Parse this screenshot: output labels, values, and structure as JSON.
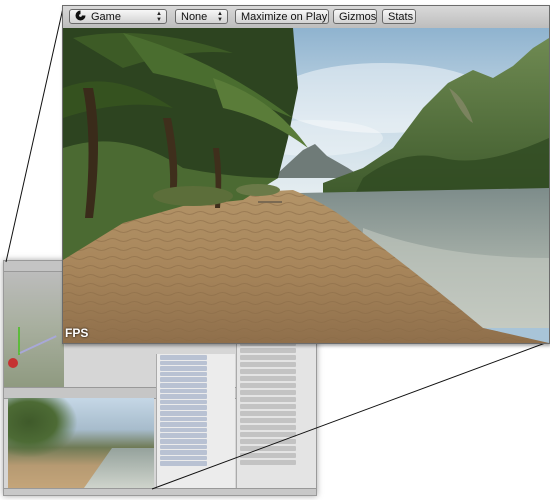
{
  "toolbar": {
    "display_dropdown": {
      "selected": "Game",
      "icon": "game-controller-icon"
    },
    "aspect_dropdown": {
      "selected": "None"
    },
    "maximize_label": "Maximize on Play",
    "gizmos_label": "Gizmos",
    "stats_label": "Stats"
  },
  "viewport": {
    "fps_label": "FPS"
  }
}
